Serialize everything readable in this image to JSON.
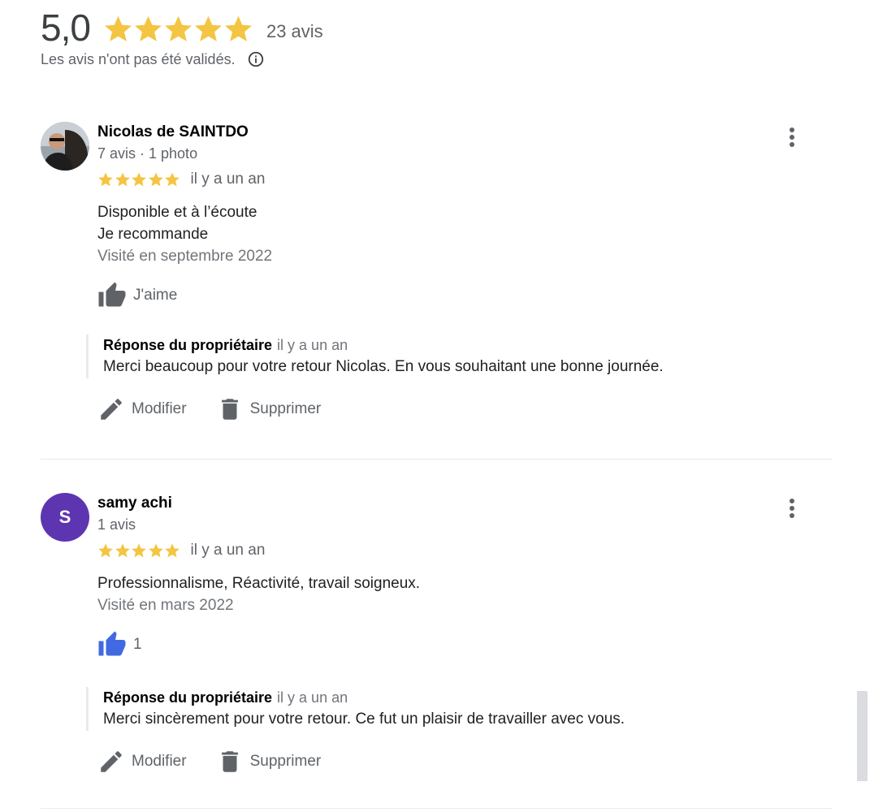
{
  "summary": {
    "score": "5,0",
    "rating": 5,
    "count": "23 avis",
    "disclaimer": "Les avis n'ont pas été validés."
  },
  "colors": {
    "star": "#f4c542",
    "like_active": "#4169e1",
    "icon_gray": "#5f6368",
    "avatar_purple": "#5e35b1"
  },
  "icons": {
    "info": "info-icon",
    "more": "more-vert-icon",
    "like": "thumb-up-icon",
    "edit": "pencil-icon",
    "delete": "trash-icon"
  },
  "reviews": [
    {
      "name": "Nicolas de SAINTDO",
      "meta": "7 avis · 1 photo",
      "rating": 5,
      "when": "il y a un an",
      "text_lines": [
        "Disponible et à l’écoute",
        "Je recommande"
      ],
      "visited": "Visité en septembre 2022",
      "like_label": "J'aime",
      "reply": {
        "title": "Réponse du propriétaire",
        "when": "il y a un an",
        "text": "Merci beaucoup pour votre retour Nicolas. En vous souhaitant une bonne journée."
      },
      "edit_label": "Modifier",
      "delete_label": "Supprimer"
    },
    {
      "name": "samy achi",
      "avatar_letter": "S",
      "meta": "1 avis",
      "rating": 5,
      "when": "il y a un an",
      "text_lines": [
        "Professionnalisme, Réactivité, travail soigneux."
      ],
      "visited": "Visité en mars 2022",
      "like_label": "1",
      "reply": {
        "title": "Réponse du propriétaire",
        "when": "il y a un an",
        "text": "Merci sincèrement pour votre retour. Ce fut un plaisir de travailler avec vous."
      },
      "edit_label": "Modifier",
      "delete_label": "Supprimer"
    }
  ]
}
